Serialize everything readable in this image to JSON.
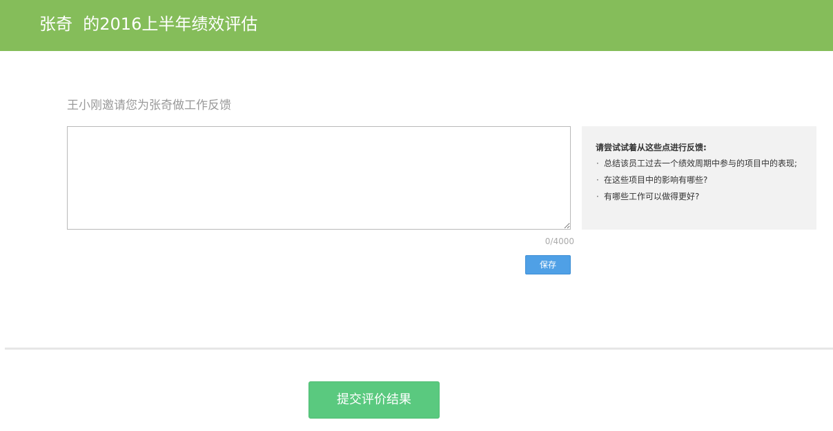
{
  "header": {
    "title": "张奇  的2016上半年绩效评估"
  },
  "invite": {
    "text": "王小刚邀请您为张奇做工作反馈"
  },
  "feedback": {
    "value": "",
    "char_count": "0/4000",
    "save_label": "保存"
  },
  "tips": {
    "title": "请尝试试着从这些点进行反馈:",
    "bullet": "·",
    "items": [
      "总结该员工过去一个绩效周期中参与的项目中的表现;",
      "在这些项目中的影响有哪些?",
      "有哪些工作可以做得更好?"
    ]
  },
  "submit": {
    "label": "提交评价结果"
  },
  "colors": {
    "header_bg": "#85bd5a",
    "save_button": "#4fa0e6",
    "submit_button": "#5ac97f",
    "tips_bg": "#f2f2f2"
  }
}
